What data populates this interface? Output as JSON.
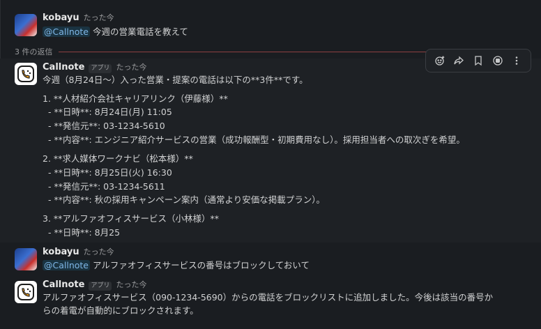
{
  "thread": {
    "parent": {
      "author": "kobayu",
      "timestamp": "たった今",
      "mention": "@Callnote",
      "text": "今週の営業電話を教えて"
    },
    "replies_label": "3 件の返信",
    "bot_reply": {
      "author": "Callnote",
      "badge": "アプリ",
      "timestamp": "たった今",
      "intro": "今週（8月24日〜）入った営業・提案の電話は以下の**3件**です。",
      "items": [
        {
          "heading": "1. **人材紹介会社キャリアリンク（伊藤様）**",
          "lines": [
            "- **日時**: 8月24日(月) 11:05",
            "- **発信元**: 03-1234-5610",
            "- **内容**: エンジニア紹介サービスの営業（成功報酬型・初期費用なし）。採用担当者への取次ぎを希望。"
          ]
        },
        {
          "heading": "2. **求人媒体ワークナビ（松本様）**",
          "lines": [
            "- **日時**: 8月25日(火) 16:30",
            "- **発信元**: 03-1234-5611",
            "- **内容**: 秋の採用キャンペーン案内（通常より安価な掲載プラン）。"
          ]
        },
        {
          "heading": "3. **アルファオフィスサービス（小林様）**",
          "lines": [
            "- **日時**: 8月25"
          ]
        }
      ]
    },
    "user_followup": {
      "author": "kobayu",
      "timestamp": "たった今",
      "mention": "@Callnote",
      "text": "アルファオフィスサービスの番号はブロックしておいて"
    },
    "bot_followup": {
      "author": "Callnote",
      "badge": "アプリ",
      "timestamp": "たった今",
      "line1": "アルファオフィスサービス（090-1234-5690）からの電話をブロックリストに追加しました。今後は該当の番号か",
      "line2": "らの着電が自動的にブロックされます。"
    }
  },
  "toolbar": {
    "icons": [
      "add-reaction-icon",
      "forward-icon",
      "bookmark-icon",
      "app-action-icon",
      "more-icon"
    ]
  },
  "colors": {
    "background": "#1a1d21",
    "hover_background": "#1e2125",
    "mention": "#7fb7e8",
    "replies_line": "#c05050"
  }
}
